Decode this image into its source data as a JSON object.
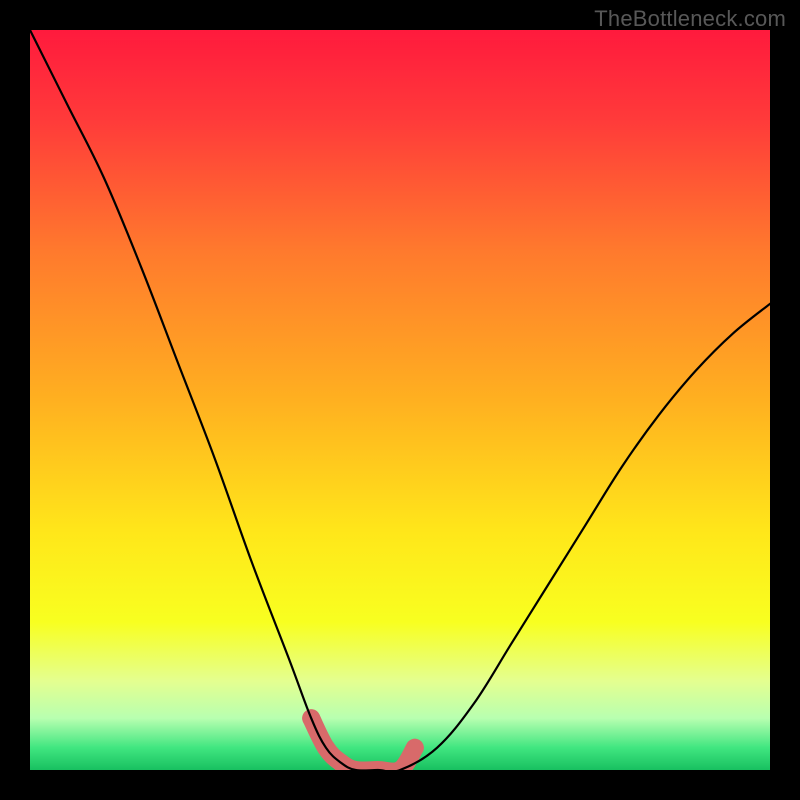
{
  "watermark": "TheBottleneck.com",
  "chart_data": {
    "type": "line",
    "title": "",
    "xlabel": "",
    "ylabel": "",
    "xlim": [
      0,
      100
    ],
    "ylim": [
      0,
      100
    ],
    "grid": false,
    "legend": false,
    "series": [
      {
        "name": "bottleneck-curve",
        "x": [
          0,
          5,
          10,
          15,
          20,
          25,
          30,
          35,
          38,
          40,
          42,
          44,
          47,
          50,
          55,
          60,
          65,
          70,
          75,
          80,
          85,
          90,
          95,
          100
        ],
        "y": [
          100,
          90,
          80,
          68,
          55,
          42,
          28,
          15,
          7,
          3,
          1,
          0,
          0,
          0,
          3,
          9,
          17,
          25,
          33,
          41,
          48,
          54,
          59,
          63
        ]
      },
      {
        "name": "optimal-zone",
        "x": [
          38,
          40,
          42,
          44,
          47,
          50,
          52
        ],
        "y": [
          7,
          3,
          1,
          0,
          0,
          0,
          3
        ]
      }
    ],
    "background_gradient": {
      "stops": [
        {
          "pos": 0.0,
          "color": "#ff1a3d"
        },
        {
          "pos": 0.12,
          "color": "#ff3a3a"
        },
        {
          "pos": 0.3,
          "color": "#ff7a2d"
        },
        {
          "pos": 0.5,
          "color": "#ffb020"
        },
        {
          "pos": 0.68,
          "color": "#ffe71a"
        },
        {
          "pos": 0.8,
          "color": "#f8ff20"
        },
        {
          "pos": 0.88,
          "color": "#e4ff90"
        },
        {
          "pos": 0.93,
          "color": "#b8ffb0"
        },
        {
          "pos": 0.97,
          "color": "#40e680"
        },
        {
          "pos": 1.0,
          "color": "#18c060"
        }
      ]
    },
    "optimal_zone_style": {
      "stroke": "#d86a6a",
      "stroke_width": 18,
      "marker_radius": 9
    },
    "curve_style": {
      "stroke": "#000000",
      "stroke_width": 2.2
    }
  }
}
